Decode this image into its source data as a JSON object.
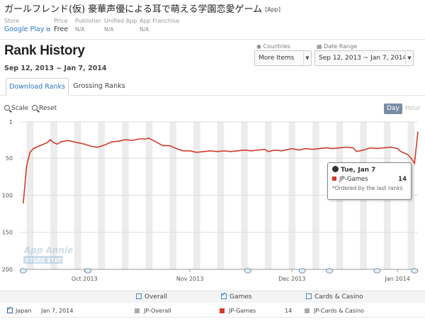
{
  "app": {
    "title": "ガールフレンド(仮) 豪華声優による耳で萌える学園恋愛ゲーム",
    "tag": "[App]"
  },
  "meta": [
    {
      "label": "Store",
      "value": "Google Play",
      "link": true
    },
    {
      "label": "Price",
      "value": "Free"
    },
    {
      "label": "Publisher",
      "value": "N/A"
    },
    {
      "label": "Unified App",
      "value": "N/A"
    },
    {
      "label": "App Franchise",
      "value": "N/A"
    }
  ],
  "header": {
    "title": "Rank History",
    "date_range": "Sep 12, 2013 ~ Jan 7, 2014"
  },
  "controls": {
    "countries_label": "Countries",
    "countries_value": "More Items",
    "date_label": "Date Range",
    "date_value": "Sep 12, 2013 ~ Jan 7, 2014"
  },
  "tabs": [
    {
      "label": "Download Ranks",
      "active": true
    },
    {
      "label": "Grossing Ranks",
      "active": false
    }
  ],
  "tools": {
    "scale": "Scale",
    "reset": "Reset"
  },
  "granularity": {
    "day": "Day",
    "hour": "Hour"
  },
  "tooltip": {
    "date": "Tue, Jan 7",
    "series": "JP-Games",
    "value": "14",
    "note": "*Ordered by the last ranks"
  },
  "legend": [
    {
      "label": "Overall",
      "checked": false
    },
    {
      "label": "Games",
      "checked": true
    },
    {
      "label": "Cards & Casino",
      "checked": false
    }
  ],
  "row": {
    "country": "Japan",
    "date": "Jan 7, 2014",
    "overall": "JP-Overall",
    "games": "JP-Games",
    "games_value": "14",
    "cards": "JP-Cards & Casino"
  },
  "watermark": {
    "line1": "App Annie",
    "line2": "STORE STATS"
  },
  "colors": {
    "line": "#d33a2a",
    "band": "#ececec",
    "link": "#2a76c4",
    "grey_square": "#aaaaaa"
  },
  "chart_data": {
    "type": "line",
    "series": [
      {
        "name": "JP-Games",
        "color": "#d33a2a"
      }
    ],
    "y_ticks": [
      "1",
      "50",
      "100",
      "150",
      "200"
    ],
    "ylim": [
      1,
      200
    ],
    "y_reversed": true,
    "x_ticks": [
      "Oct 2013",
      "Nov 2013",
      "Dec 2013",
      "Jan 2014"
    ],
    "x_tick_dates": [
      "2013-10-01",
      "2013-11-01",
      "2013-12-01",
      "2014-01-01"
    ],
    "x_range": [
      "2013-09-12",
      "2014-01-07"
    ],
    "points": [
      [
        "2013-09-13",
        111
      ],
      [
        "2013-09-14",
        60
      ],
      [
        "2013-09-15",
        42
      ],
      [
        "2013-09-16",
        37
      ],
      [
        "2013-09-18",
        33
      ],
      [
        "2013-09-20",
        29
      ],
      [
        "2013-09-21",
        25
      ],
      [
        "2013-09-22",
        29
      ],
      [
        "2013-09-23",
        31
      ],
      [
        "2013-09-24",
        28
      ],
      [
        "2013-09-26",
        26
      ],
      [
        "2013-09-28",
        28
      ],
      [
        "2013-10-01",
        31
      ],
      [
        "2013-10-03",
        34
      ],
      [
        "2013-10-05",
        35
      ],
      [
        "2013-10-07",
        32
      ],
      [
        "2013-10-09",
        28
      ],
      [
        "2013-10-11",
        27
      ],
      [
        "2013-10-13",
        25
      ],
      [
        "2013-10-15",
        26
      ],
      [
        "2013-10-17",
        24
      ],
      [
        "2013-10-19",
        24
      ],
      [
        "2013-10-20",
        23
      ],
      [
        "2013-10-22",
        28
      ],
      [
        "2013-10-24",
        33
      ],
      [
        "2013-10-26",
        33
      ],
      [
        "2013-10-28",
        37
      ],
      [
        "2013-10-30",
        40
      ],
      [
        "2013-11-01",
        40
      ],
      [
        "2013-11-03",
        42
      ],
      [
        "2013-11-05",
        41
      ],
      [
        "2013-11-07",
        40
      ],
      [
        "2013-11-09",
        41
      ],
      [
        "2013-11-11",
        40
      ],
      [
        "2013-11-13",
        41
      ],
      [
        "2013-11-15",
        40
      ],
      [
        "2013-11-17",
        39
      ],
      [
        "2013-11-19",
        40
      ],
      [
        "2013-11-21",
        39
      ],
      [
        "2013-11-23",
        38
      ],
      [
        "2013-11-24",
        41
      ],
      [
        "2013-11-26",
        39
      ],
      [
        "2013-11-28",
        40
      ],
      [
        "2013-11-30",
        38
      ],
      [
        "2013-12-01",
        37
      ],
      [
        "2013-12-03",
        39
      ],
      [
        "2013-12-05",
        37
      ],
      [
        "2013-12-07",
        38
      ],
      [
        "2013-12-09",
        37
      ],
      [
        "2013-12-11",
        36
      ],
      [
        "2013-12-13",
        37
      ],
      [
        "2013-12-15",
        36
      ],
      [
        "2013-12-17",
        35
      ],
      [
        "2013-12-19",
        36
      ],
      [
        "2013-12-20",
        41
      ],
      [
        "2013-12-22",
        39
      ],
      [
        "2013-12-24",
        36
      ],
      [
        "2013-12-26",
        37
      ],
      [
        "2013-12-28",
        36
      ],
      [
        "2013-12-30",
        35
      ],
      [
        "2014-01-01",
        37
      ],
      [
        "2014-01-02",
        41
      ],
      [
        "2014-01-03",
        43
      ],
      [
        "2014-01-04",
        45
      ],
      [
        "2014-01-05",
        50
      ],
      [
        "2014-01-06",
        57
      ],
      [
        "2014-01-07",
        14
      ]
    ]
  }
}
